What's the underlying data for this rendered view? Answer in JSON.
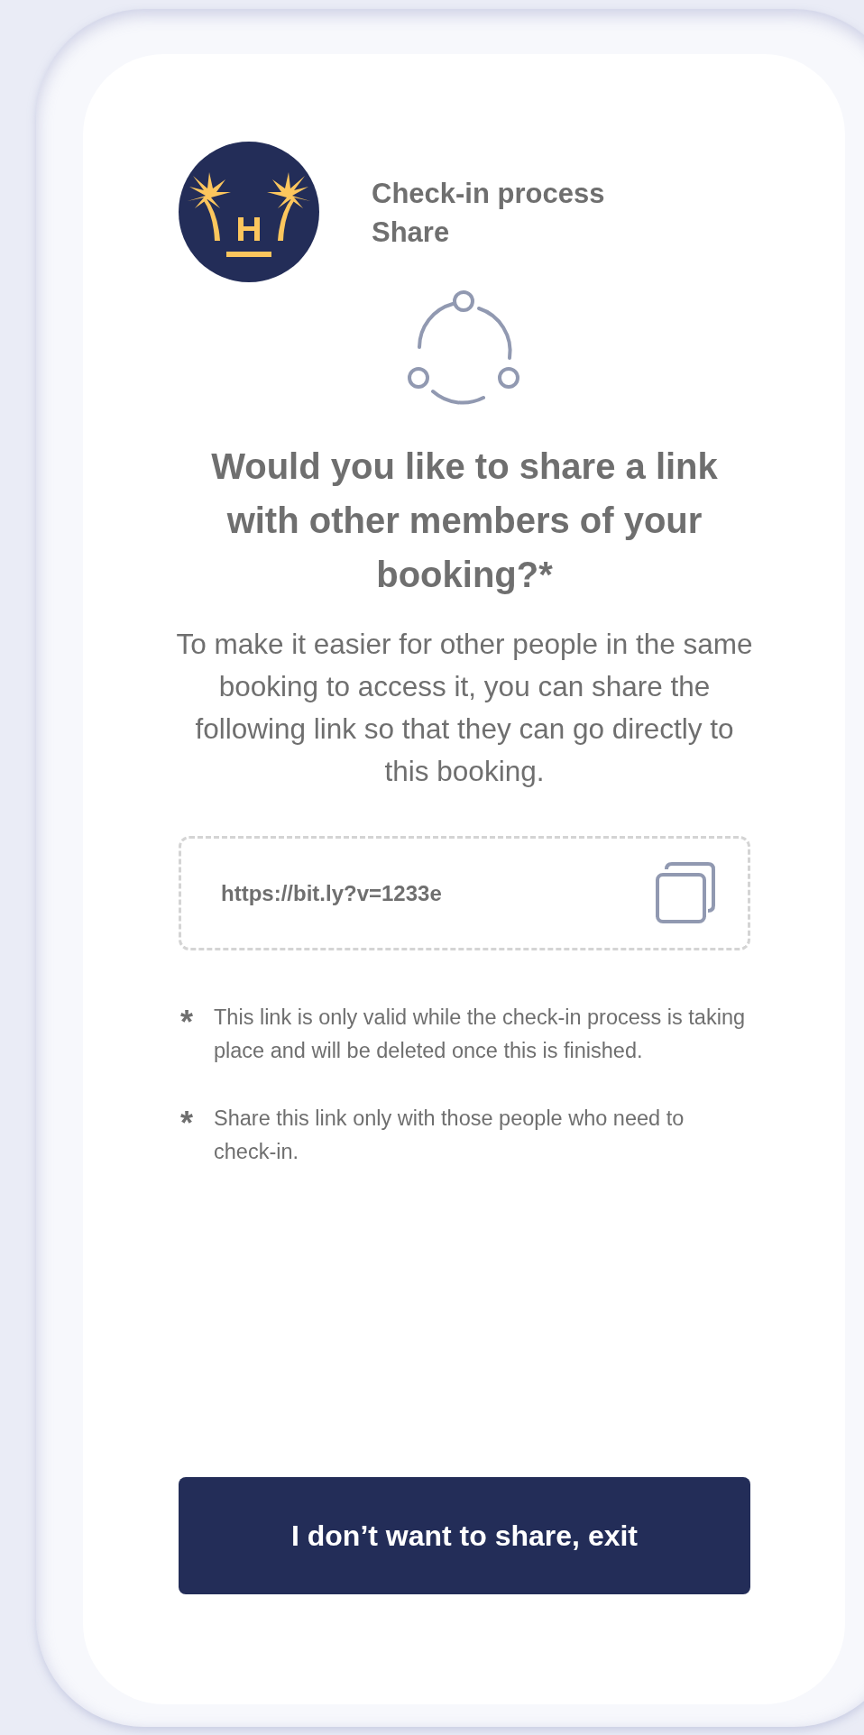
{
  "header": {
    "title": "Check-in process",
    "subtitle": "Share"
  },
  "question": "Would you like to share a link with other members of your booking?*",
  "description": "To make it easier for other people in the same booking to access it, you can share the following link so that they can go directly to this booking.",
  "share_link": {
    "value": "https://bit.ly?v=1233e"
  },
  "notes": [
    {
      "mark": "*",
      "text": "This link is only valid while the check-in process is taking place and will be deleted once this is finished."
    },
    {
      "mark": "*",
      "text": "Share this link only with those people who need to check-in."
    }
  ],
  "exit_button": {
    "label": "I don’t want to share, exit"
  }
}
